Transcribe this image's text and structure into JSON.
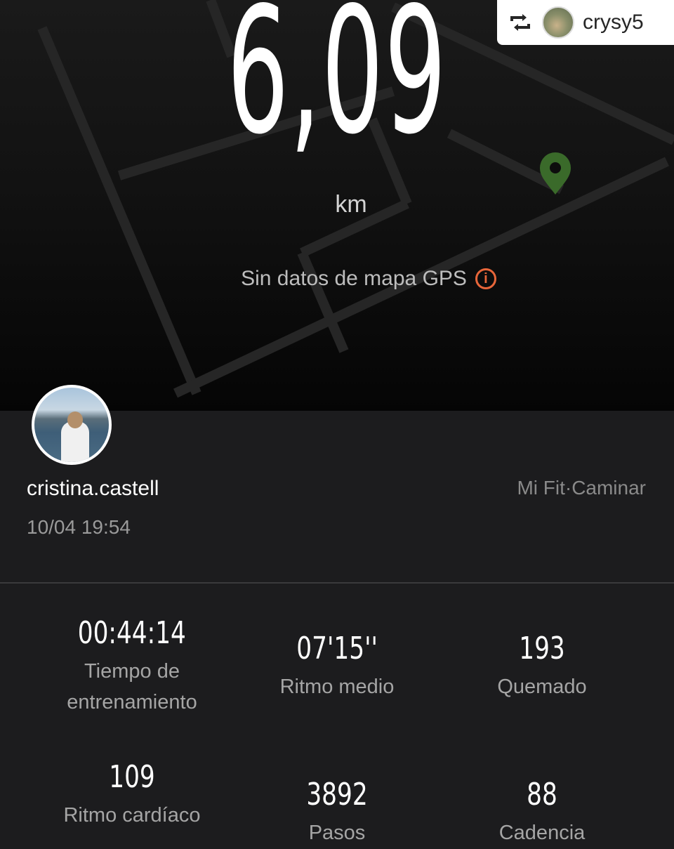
{
  "repost": {
    "username": "crysy5"
  },
  "workout": {
    "distance": "6,09",
    "unit": "km",
    "gps_message": "Sin datos de mapa GPS",
    "map_pin_color": "#3a6a2a",
    "accent_color": "#e8663a"
  },
  "profile": {
    "username": "cristina.castell",
    "datetime": "10/04 19:54",
    "source": "Mi Fit·Caminar"
  },
  "stats": [
    {
      "value": "00:44:14",
      "label_line1": "Tiempo de",
      "label_line2": "entrenamiento"
    },
    {
      "value": "07'15''",
      "label_line1": "Ritmo medio",
      "label_line2": ""
    },
    {
      "value": "193",
      "label_line1": "Quemado",
      "label_line2": ""
    },
    {
      "value": "109",
      "label_line1": "Ritmo cardíaco",
      "label_line2": ""
    },
    {
      "value": "3892",
      "label_line1": "Pasos",
      "label_line2": ""
    },
    {
      "value": "88",
      "label_line1": "Cadencia",
      "label_line2": ""
    }
  ],
  "icons": {
    "repost": "repost-icon",
    "gps_info": "info-icon",
    "map_pin": "map-pin-icon"
  }
}
